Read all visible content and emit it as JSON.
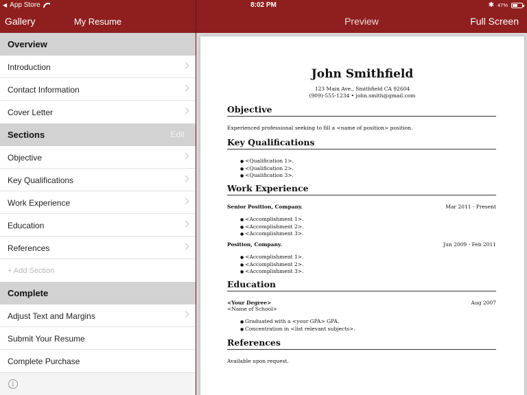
{
  "status": {
    "carrier": "App Store",
    "time": "8:02 PM",
    "battery": "47%"
  },
  "nav": {
    "gallery": "Gallery",
    "title": "My Resume",
    "preview": "Preview",
    "fullscreen": "Full Screen"
  },
  "sidebar": {
    "overview_header": "Overview",
    "overview_items": [
      "Introduction",
      "Contact Information",
      "Cover Letter"
    ],
    "sections_header": "Sections",
    "edit": "Edit",
    "sections_items": [
      "Objective",
      "Key Qualifications",
      "Work Experience",
      "Education",
      "References"
    ],
    "add_section": "+ Add Section",
    "complete_header": "Complete",
    "complete_items": [
      "Adjust Text and Margins",
      "Submit Your Resume",
      "Complete Purchase"
    ]
  },
  "resume": {
    "name": "John Smithfield",
    "address": "123 Main Ave., Smithfield CA 92604",
    "contact": "(909)-555-1234 • john.smith@gmail.com",
    "objective_h": "Objective",
    "objective_text": "Experienced professional seeking to fill a <name of position> position.",
    "qual_h": "Key Qualifications",
    "quals": [
      "<Qualification 1>.",
      "<Qualification 2>.",
      "<Qualification 3>."
    ],
    "work_h": "Work Experience",
    "job1_title": "Senior Position, Company.",
    "job1_dates": "Mar 2011 - Present",
    "job1_items": [
      "<Accomplishment 1>.",
      "<Accomplishment 2>.",
      "<Accomplishment 3>."
    ],
    "job2_title": "Position, Company.",
    "job2_dates": "Jun 2009 - Feb 2011",
    "job2_items": [
      "<Accomplishment 1>.",
      "<Accomplishment 2>.",
      "<Accomplishment 3>."
    ],
    "edu_h": "Education",
    "degree": "<Your Degree>",
    "edu_date": "Aug 2007",
    "school": "<Name of School>",
    "edu_items": [
      "Graduated with a <your GPA> GPA.",
      "Concentration in <list relevant subjects>."
    ],
    "ref_h": "References",
    "ref_text": "Available upon request."
  }
}
